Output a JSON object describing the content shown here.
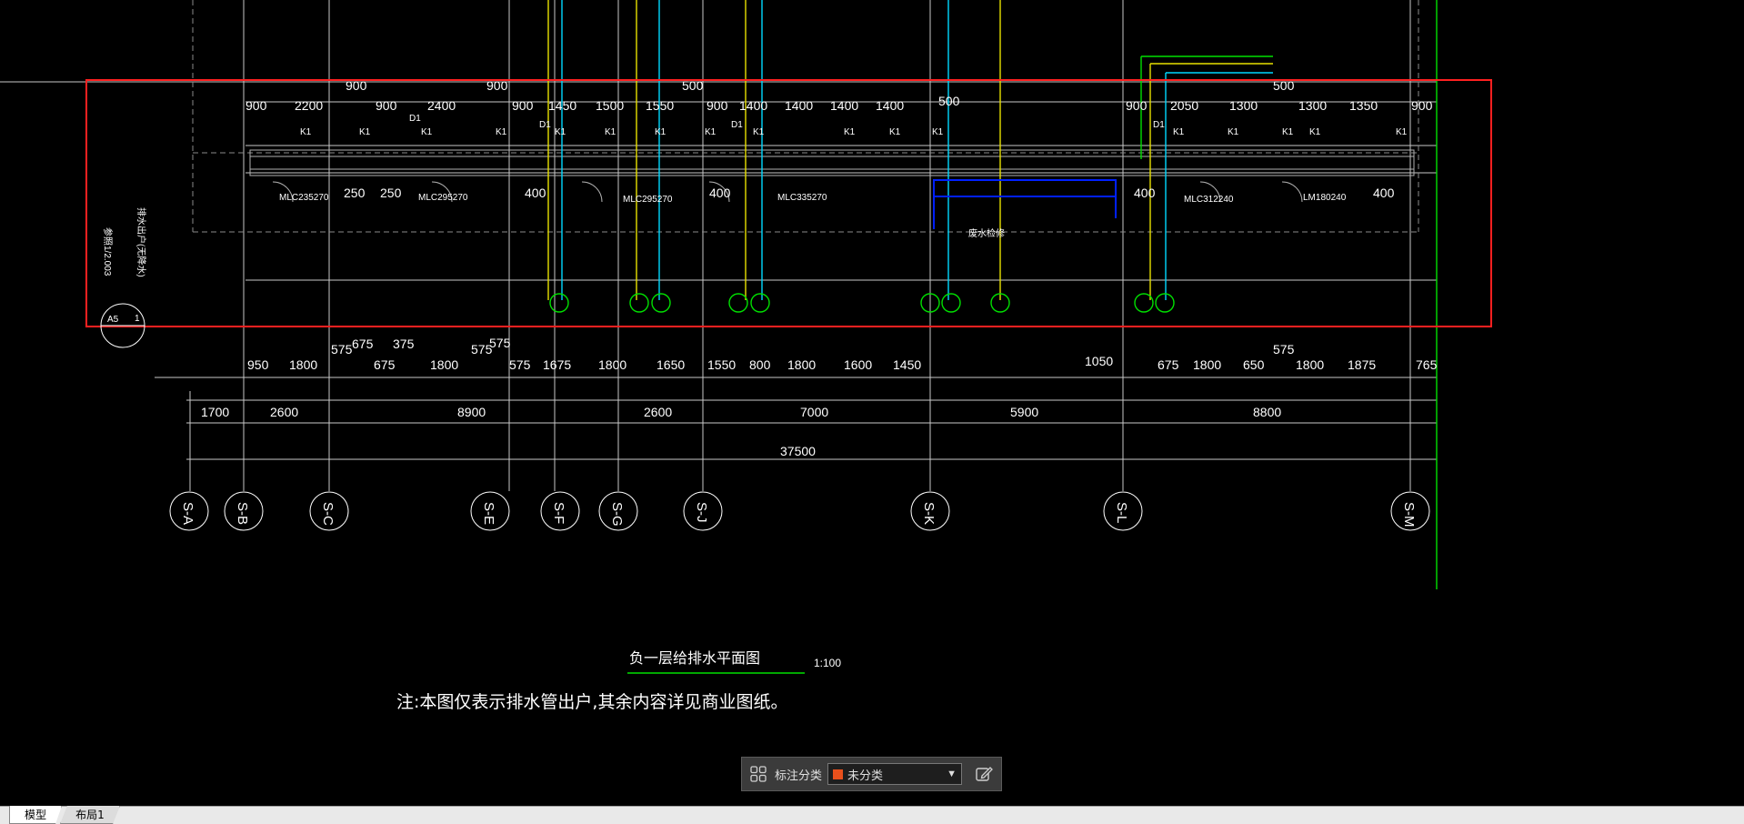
{
  "drawing": {
    "top_dims": [
      "900",
      "2200",
      "900",
      "2400",
      "900",
      "1450",
      "1500",
      "1550",
      "900",
      "1400",
      "1400",
      "1400",
      "1400",
      "900",
      "2050",
      "1300",
      "1300",
      "1350",
      "900"
    ],
    "segment_dims_a": [
      "950",
      "1800",
      "675",
      "1800",
      "575",
      "1675",
      "1800",
      "1650",
      "1550",
      "800",
      "1800",
      "1600",
      "1450",
      "1050",
      "675",
      "1800",
      "650",
      "1800",
      "1875",
      "765"
    ],
    "segment_dims_b": [
      "1700",
      "2600",
      "8900",
      "2600",
      "7000",
      "5900",
      "8800"
    ],
    "total_dim": "37500",
    "axes": [
      "S-A",
      "S-B",
      "S-C",
      "S-E",
      "S-F",
      "S-G",
      "S-J",
      "S-K",
      "S-L",
      "S-M"
    ],
    "window_tags": [
      "MLC235270",
      "MLC295270",
      "MLC295270",
      "MLC335270",
      "MLC312240",
      "LM180240"
    ],
    "misc_dims": [
      "250",
      "250",
      "400",
      "400",
      "400",
      "400",
      "500",
      "500",
      "500",
      "900",
      "900",
      "575",
      "575",
      "575",
      "575",
      "375",
      "675"
    ],
    "k1_label": "K1",
    "d1_label": "D1",
    "side_note_1": "排水出户(无降水)",
    "side_note_2": "参照1/2.003",
    "side_circle_num": "1",
    "side_circle_ref": "A5",
    "riser_note": "废水检修",
    "title": "负一层给排水平面图",
    "scale": "1:100",
    "note": "注:本图仅表示排水管出户,其余内容详见商业图纸。"
  },
  "annotation_toolbar": {
    "label": "标注分类",
    "selected": "未分类",
    "swatch_color": "#e8501c"
  },
  "tabs": [
    {
      "label": "模型",
      "active": true
    },
    {
      "label": "布局1",
      "active": false
    }
  ],
  "colors": {
    "highlight_rect": "#ff2020",
    "pipe_yellow": "#e8e000",
    "pipe_cyan": "#00d8ff",
    "pipe_green": "#00e000",
    "pipe_blue": "#0020ff",
    "dim_white": "#ffffff",
    "dashed_gray": "#8a8a8a"
  }
}
